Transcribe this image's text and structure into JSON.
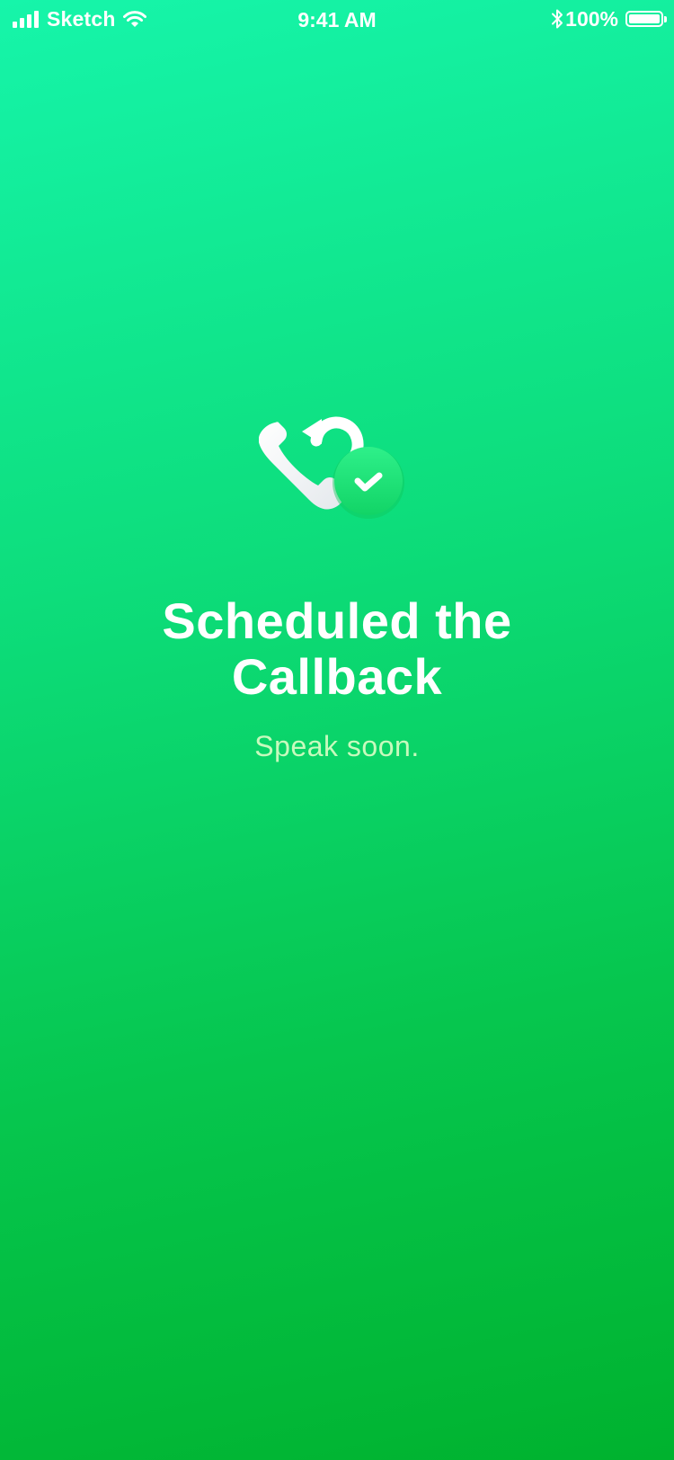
{
  "status_bar": {
    "carrier": "Sketch",
    "time": "9:41 AM",
    "battery_percent": "100%",
    "signal_icon": "signal-bars-icon",
    "wifi_icon": "wifi-icon",
    "bluetooth_icon": "bluetooth-icon",
    "battery_icon": "battery-icon"
  },
  "confirmation": {
    "icon": "phone-callback-check-icon",
    "title_line1": "Scheduled the",
    "title_line2": "Callback",
    "subtitle": "Speak soon."
  },
  "colors": {
    "gradient_top": "#16f5aa",
    "gradient_bottom": "#00b22e",
    "badge_green": "#1fe079",
    "text": "#ffffff"
  }
}
